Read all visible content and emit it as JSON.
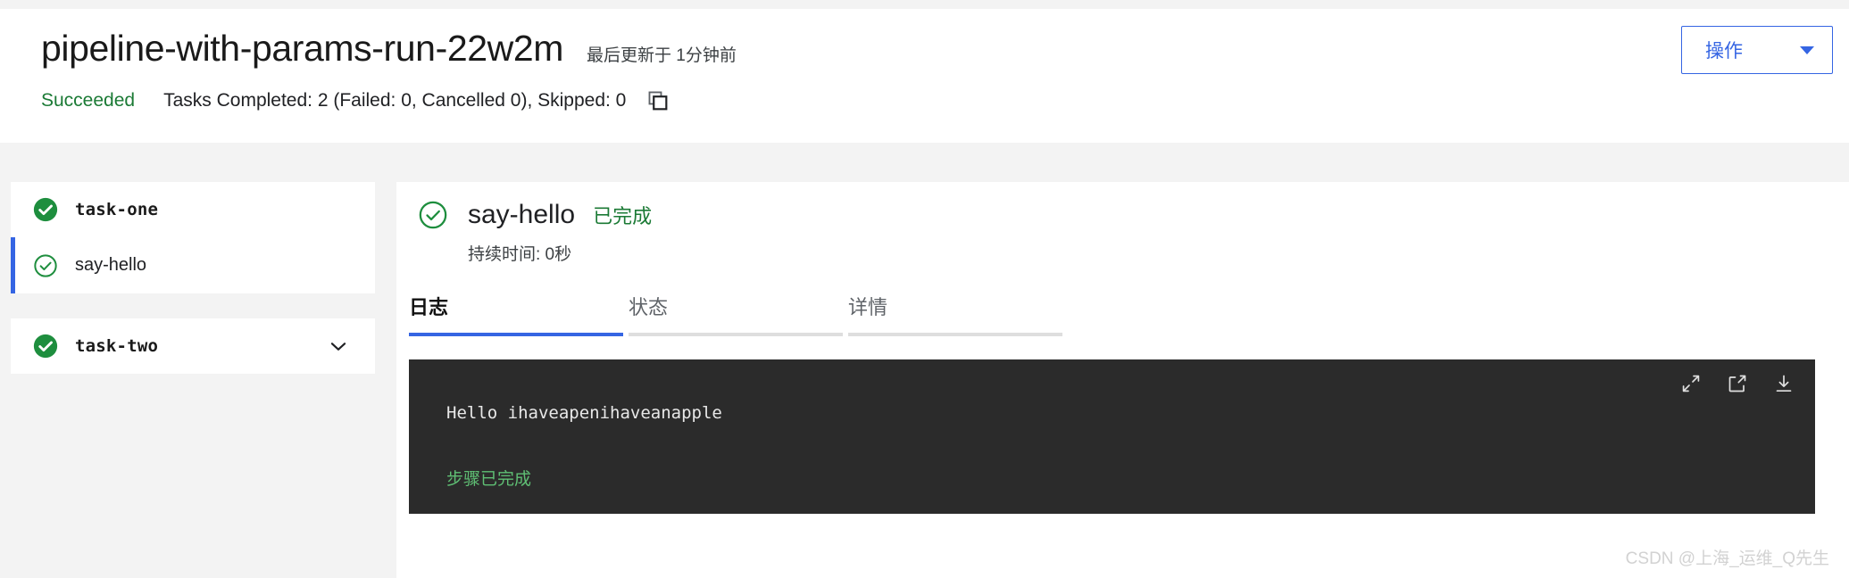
{
  "colors": {
    "accent_blue": "#3565e3",
    "success_green": "#1b7a35",
    "log_green": "#5fbf74",
    "page_bg": "#f3f3f3",
    "panel_bg": "#ffffff",
    "log_bg": "#2b2b2b",
    "watermark": "#d2d2d2"
  },
  "header": {
    "run_title": "pipeline-with-params-run-22w2m",
    "updated_at": "最后更新于 1分钟前",
    "status": "Succeeded",
    "tasks_summary": "Tasks Completed: 2 (Failed: 0, Cancelled 0), Skipped: 0",
    "copy_icon": "copy-icon",
    "actions": {
      "label": "操作",
      "caret_icon": "chevron-down-icon"
    }
  },
  "sidebar": {
    "groups": [
      {
        "task": {
          "label": "task-one",
          "status_icon": "check-circle-filled-icon",
          "selected": false,
          "has_chevron": false
        },
        "steps": [
          {
            "label": "say-hello",
            "status_icon": "check-circle-outline-icon",
            "selected": true
          }
        ]
      },
      {
        "task": {
          "label": "task-two",
          "status_icon": "check-circle-filled-icon",
          "selected": false,
          "has_chevron": true,
          "chevron_icon": "chevron-down-icon"
        },
        "steps": []
      }
    ]
  },
  "main": {
    "step": {
      "status_icon": "check-circle-outline-icon",
      "name": "say-hello",
      "state": "已完成",
      "duration": "持续时间: 0秒"
    },
    "tabs": [
      {
        "label": "日志",
        "active": true
      },
      {
        "label": "状态",
        "active": false
      },
      {
        "label": "详情",
        "active": false
      }
    ],
    "log": {
      "tools": [
        {
          "name": "expand-icon"
        },
        {
          "name": "open-external-icon"
        },
        {
          "name": "download-icon"
        }
      ],
      "lines": [
        {
          "text": "Hello ihaveapenihaveanapple",
          "kind": "stdout"
        },
        {
          "text": "步骤已完成",
          "kind": "done"
        }
      ]
    }
  },
  "watermark": "CSDN @上海_运维_Q先生"
}
